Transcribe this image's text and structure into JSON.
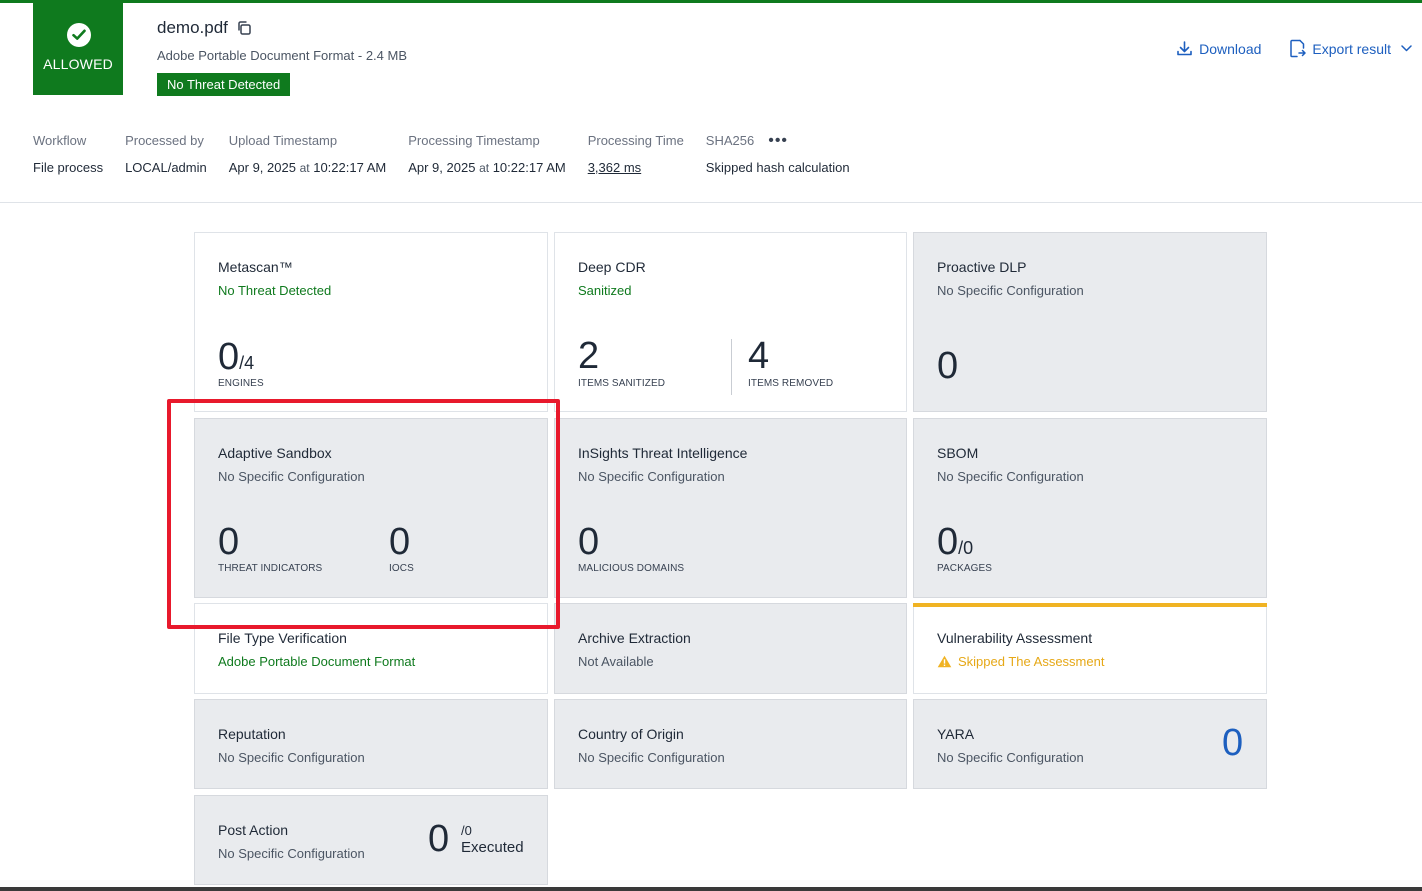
{
  "verdict": {
    "label": "ALLOWED",
    "color": "#0f7a1e",
    "icon": "check-circle-icon"
  },
  "file": {
    "name": "demo.pdf",
    "meta": "Adobe Portable Document Format - 2.4 MB",
    "status_badge": "No Threat Detected"
  },
  "actions": {
    "download": "Download",
    "export": "Export result"
  },
  "metadata": {
    "workflow": {
      "label": "Workflow",
      "value": "File process"
    },
    "processed_by": {
      "label": "Processed by",
      "value": "LOCAL/admin"
    },
    "upload": {
      "label": "Upload Timestamp",
      "date": "Apr 9, 2025",
      "at": "at",
      "time": "10:22:17 AM"
    },
    "processing": {
      "label": "Processing Timestamp",
      "date": "Apr 9, 2025",
      "at": "at",
      "time": "10:22:17 AM"
    },
    "processing_time": {
      "label": "Processing Time",
      "value": "3,362 ms"
    },
    "sha256": {
      "label": "SHA256",
      "value": "Skipped hash calculation"
    }
  },
  "cards": {
    "metascan": {
      "title": "Metascan™",
      "status": "No Threat Detected",
      "count": "0",
      "total": "/4",
      "caption": "ENGINES"
    },
    "deep_cdr": {
      "title": "Deep CDR",
      "status": "Sanitized",
      "sanitized": "2",
      "sanitized_caption": "ITEMS SANITIZED",
      "removed": "4",
      "removed_caption": "ITEMS REMOVED"
    },
    "proactive_dlp": {
      "title": "Proactive DLP",
      "status": "No Specific Configuration",
      "count": "0"
    },
    "adaptive_sandbox": {
      "title": "Adaptive Sandbox",
      "status": "No Specific Configuration",
      "threat_indicators": "0",
      "threat_indicators_caption": "THREAT INDICATORS",
      "iocs": "0",
      "iocs_caption": "IOCS"
    },
    "insights": {
      "title": "InSights Threat Intelligence",
      "status": "No Specific Configuration",
      "count": "0",
      "caption": "MALICIOUS DOMAINS"
    },
    "sbom": {
      "title": "SBOM",
      "status": "No Specific Configuration",
      "count": "0",
      "total": "/0",
      "caption": "PACKAGES"
    },
    "file_type": {
      "title": "File Type Verification",
      "status": "Adobe Portable Document Format"
    },
    "archive": {
      "title": "Archive Extraction",
      "status": "Not Available"
    },
    "vulnerability": {
      "title": "Vulnerability Assessment",
      "status": "Skipped The Assessment",
      "warn_color": "#f0b323"
    },
    "reputation": {
      "title": "Reputation",
      "status": "No Specific Configuration"
    },
    "country": {
      "title": "Country of Origin",
      "status": "No Specific Configuration"
    },
    "yara": {
      "title": "YARA",
      "status": "No Specific Configuration",
      "count": "0"
    },
    "post_action": {
      "title": "Post Action",
      "status": "No Specific Configuration",
      "count": "0",
      "total": "/0",
      "caption": "Executed"
    }
  },
  "highlight_color": "#e8192c"
}
